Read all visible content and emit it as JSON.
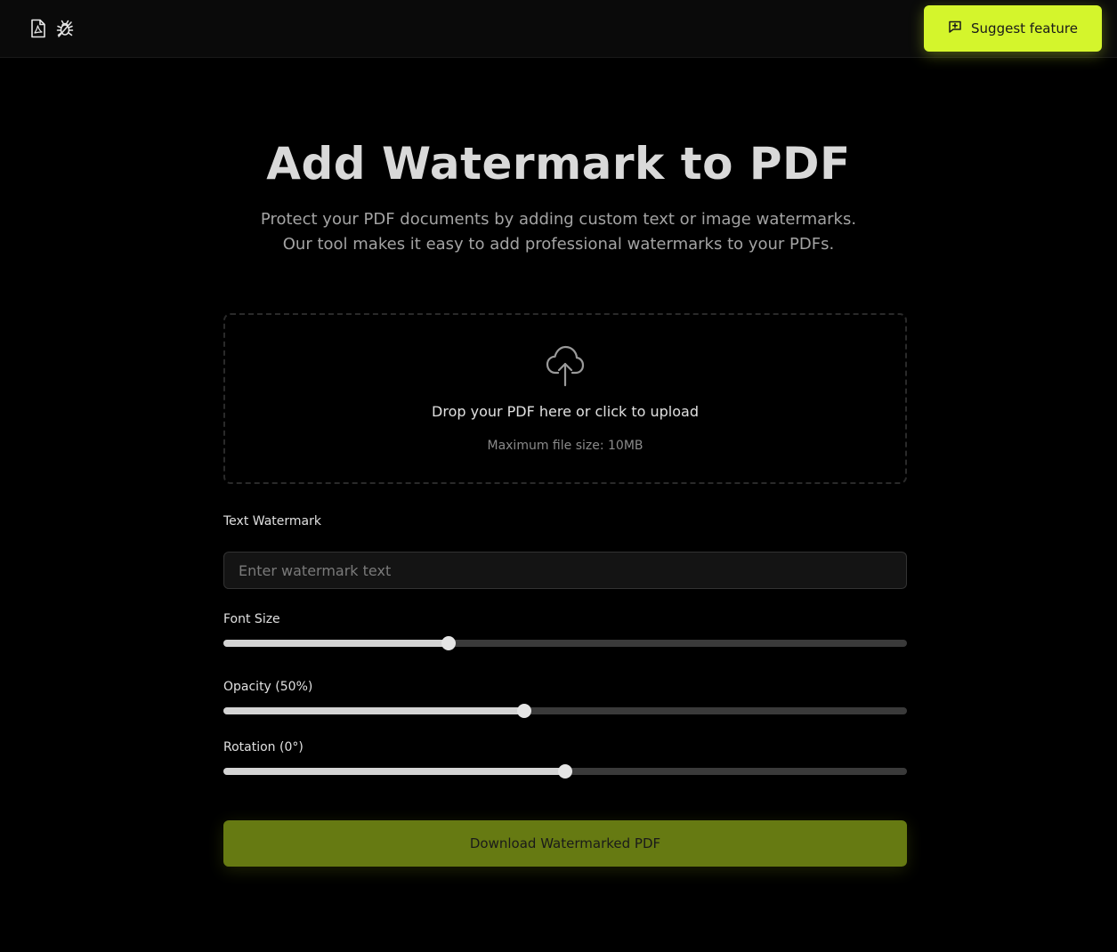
{
  "header": {
    "icons": [
      "pdf-file-icon",
      "bug-icon"
    ],
    "suggest_button": {
      "label": "Suggest feature",
      "icon": "message-square-plus-icon"
    }
  },
  "main": {
    "title": "Add Watermark to PDF",
    "subtitle_line1": "Protect your PDF documents by adding custom text or image watermarks.",
    "subtitle_line2": "Our tool makes it easy to add professional watermarks to your PDFs.",
    "upload": {
      "icon": "cloud-upload-icon",
      "text": "Drop your PDF here or click to upload",
      "max_size": "Maximum file size: 10MB"
    },
    "text_watermark": {
      "label": "Text Watermark",
      "placeholder": "Enter watermark text",
      "value": ""
    },
    "font_size": {
      "label": "Font Size",
      "level": 0.33
    },
    "opacity": {
      "label": "Opacity (50%)",
      "level": 0.44
    },
    "rotation": {
      "label": "Rotation (0°)",
      "level": 0.5
    },
    "download_button": {
      "label": "Download Watermarked PDF"
    }
  },
  "colors": {
    "accent": "#d4f52c",
    "download_button": "#667a12",
    "background": "#000000"
  }
}
